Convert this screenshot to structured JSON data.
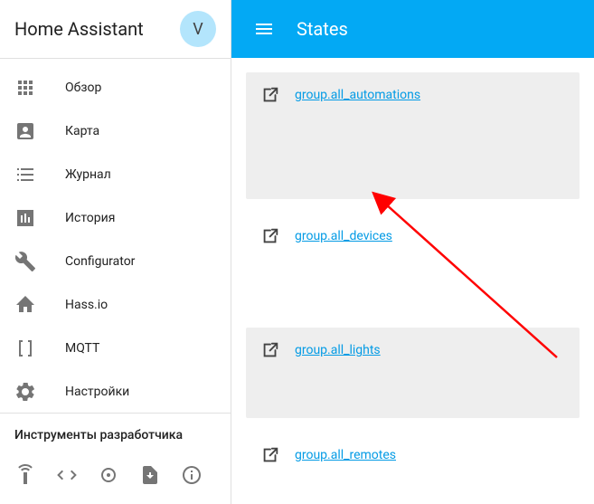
{
  "header": {
    "brand": "Home Assistant",
    "avatar_initial": "V"
  },
  "sidebar": {
    "items": [
      {
        "icon": "dashboard",
        "label": "Обзор"
      },
      {
        "icon": "account-box",
        "label": "Карта"
      },
      {
        "icon": "list",
        "label": "Журнал"
      },
      {
        "icon": "chart",
        "label": "История"
      },
      {
        "icon": "wrench",
        "label": "Configurator"
      },
      {
        "icon": "hassio",
        "label": "Hass.io"
      },
      {
        "icon": "brackets",
        "label": "MQTT"
      },
      {
        "icon": "gear",
        "label": "Настройки"
      }
    ],
    "dev_title": "Инструменты разработчика"
  },
  "topbar": {
    "title": "States"
  },
  "entities": [
    {
      "id": "group.all_automations",
      "card": true
    },
    {
      "id": "group.all_devices",
      "card": false
    },
    {
      "id": "group.all_lights",
      "card": true
    },
    {
      "id": "group.all_remotes",
      "card": false
    }
  ]
}
